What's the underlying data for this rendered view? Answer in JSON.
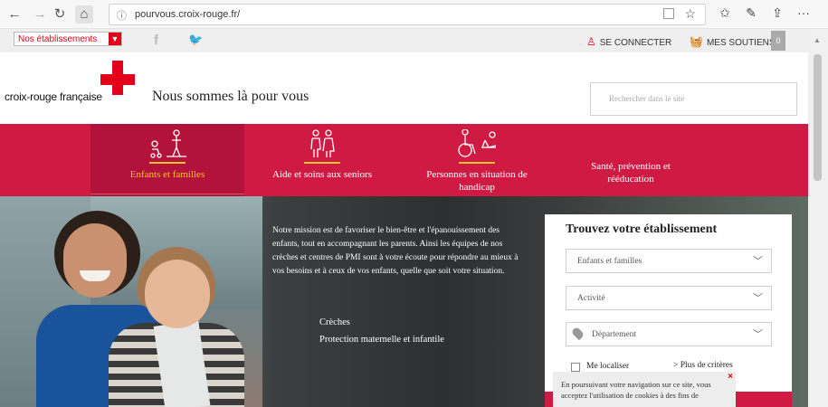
{
  "browser": {
    "url": "pourvous.croix-rouge.fr/",
    "back_icon": "←",
    "forward_icon": "→",
    "reload_icon": "↻",
    "home_icon": "⌂",
    "info_icon": "ⓘ",
    "star_icon": "☆",
    "favorites_icon": "✩",
    "pen_icon": "✎",
    "share_icon": "⇪",
    "more_icon": "···"
  },
  "topbar": {
    "establishments_select": "Nos établissements",
    "facebook": "f",
    "twitter": "🐦",
    "login_label": "SE CONNECTER",
    "donations_label": "MES SOUTIENS",
    "donations_count": "0"
  },
  "header": {
    "logo_text": "croix-rouge française",
    "tagline": "Nous sommes là pour vous",
    "search_placeholder": "Rechercher dans le site"
  },
  "nav": {
    "items": [
      {
        "label": "Enfants et familles",
        "icon": "family-icon",
        "active": true
      },
      {
        "label": "Aide et soins aux seniors",
        "icon": "seniors-icon",
        "active": false
      },
      {
        "label": "Personnes en situation de handicap",
        "icon": "handicap-icon",
        "active": false
      },
      {
        "label": "Santé, prévention et rééducation",
        "icon": "health-icon",
        "active": false
      }
    ]
  },
  "hero": {
    "text": "Notre mission est de favoriser le bien-être et l'épanouissement des enfants, tout en accompagnant les parents. Ainsi les équipes de nos crèches et centres de PMI sont à votre écoute pour répondre au mieux à vos besoins et à ceux de vos enfants, quelle que soit votre situation.",
    "links": [
      "Crèches",
      "Protection maternelle et infantile"
    ]
  },
  "finder": {
    "title": "Trouvez votre établissement",
    "selects": [
      {
        "value": "Enfants et familles"
      },
      {
        "value": "Activité"
      },
      {
        "value": "Département"
      }
    ],
    "localiser_label": "Me localiser",
    "more_criteria": "> Plus de critères"
  },
  "cookie": {
    "text": "En poursuivant votre navigation sur ce site, vous acceptez l'utilisation de cookies à des fins de",
    "close": "×"
  },
  "colors": {
    "brand_red": "#e2001a",
    "nav_red": "#cf1a44",
    "active_yellow": "#f7c42d"
  }
}
